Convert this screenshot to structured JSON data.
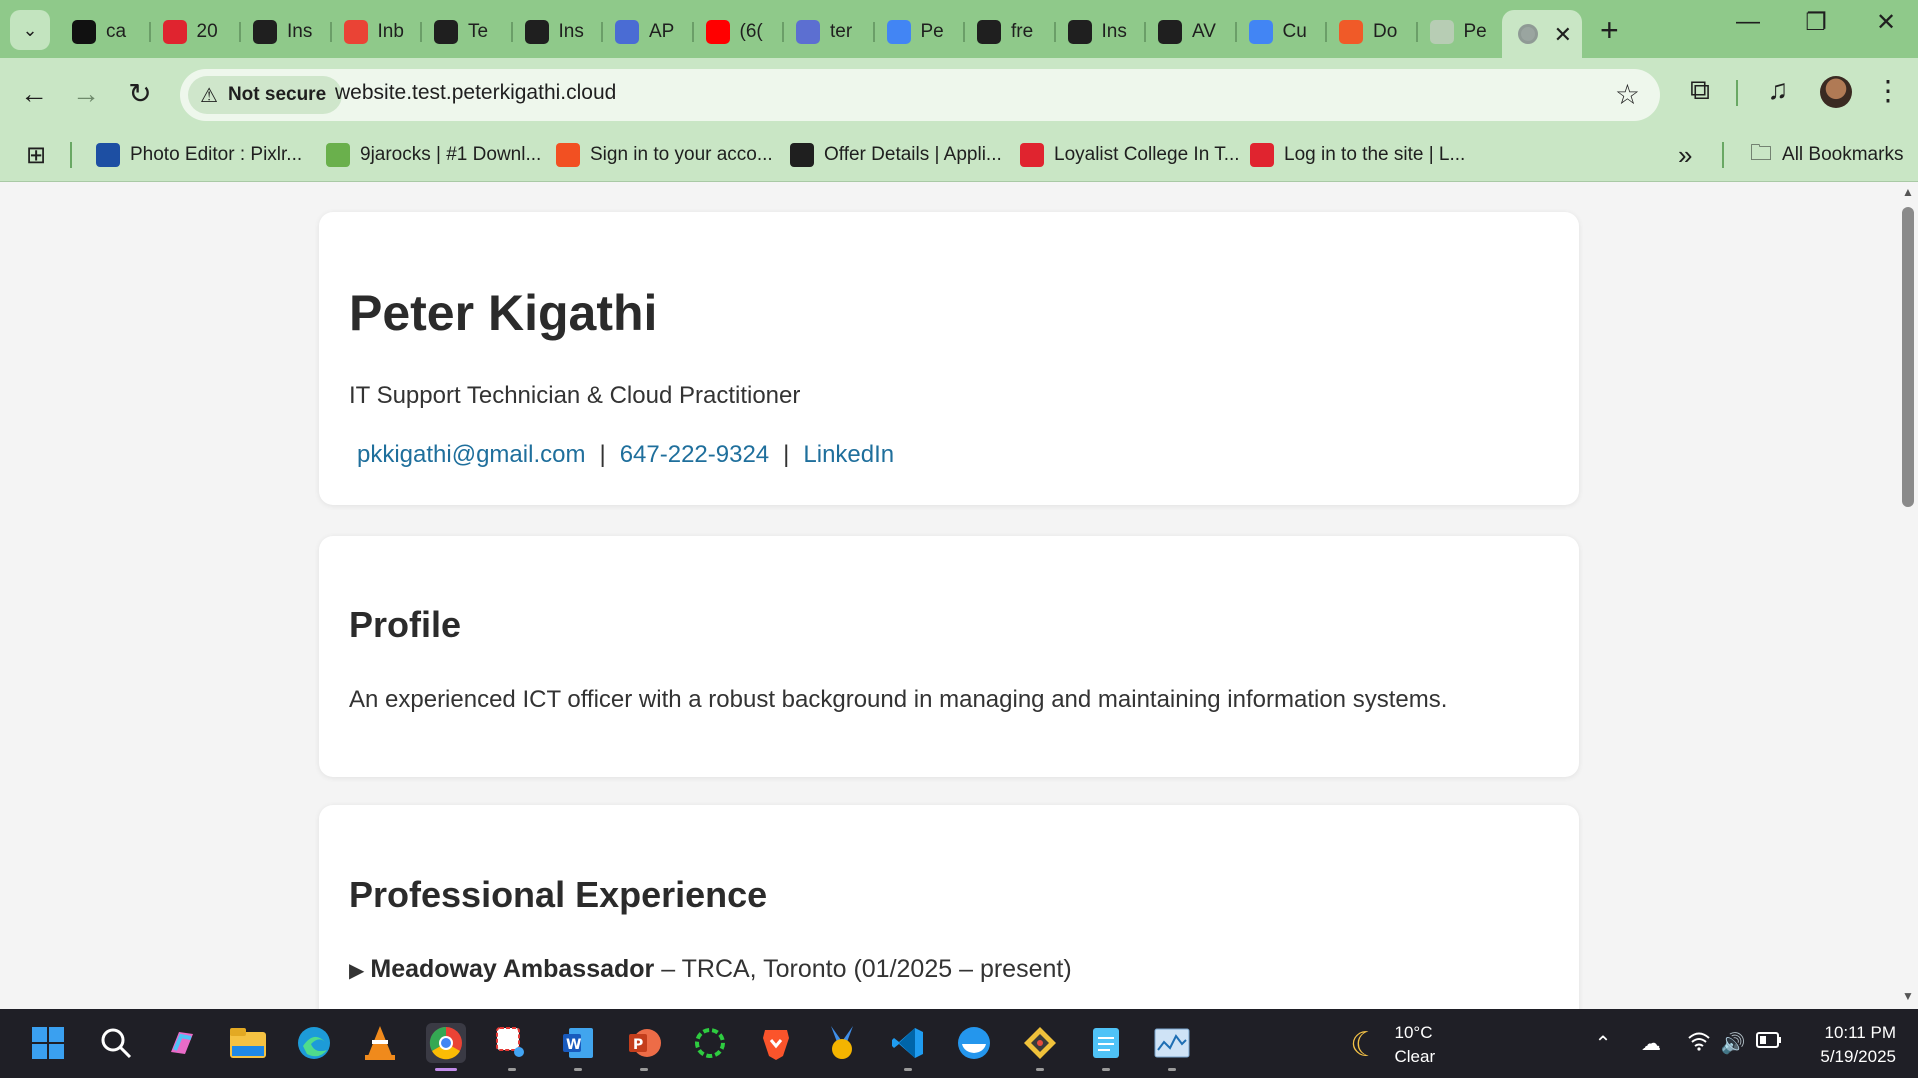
{
  "browser": {
    "tabs": [
      {
        "title": "ca",
        "icon": "tiktok-icon",
        "color": "#111111"
      },
      {
        "title": "20",
        "icon": "loyalist-icon",
        "color": "#e0242f"
      },
      {
        "title": "Ins",
        "icon": "hackerrank-icon",
        "color": "#1f1f1f"
      },
      {
        "title": "Inb",
        "icon": "gmail-icon",
        "color": "#ea4335"
      },
      {
        "title": "Te",
        "icon": "openai-icon",
        "color": "#1f1f1f"
      },
      {
        "title": "Ins",
        "icon": "openai-icon",
        "color": "#1f1f1f"
      },
      {
        "title": "AP",
        "icon": "api-icon",
        "color": "#4a6cd4"
      },
      {
        "title": "(6(",
        "icon": "youtube-icon",
        "color": "#ff0000"
      },
      {
        "title": "ter",
        "icon": "terraform-icon",
        "color": "#5c6fd1"
      },
      {
        "title": "Pe",
        "icon": "docs-icon",
        "color": "#4285f4"
      },
      {
        "title": "fre",
        "icon": "github-icon",
        "color": "#1f1f1f"
      },
      {
        "title": "Ins",
        "icon": "hackerrank-icon",
        "color": "#1f1f1f"
      },
      {
        "title": "AV",
        "icon": "openai-icon",
        "color": "#1f1f1f"
      },
      {
        "title": "Cu",
        "icon": "gcloud-icon",
        "color": "#4285f4"
      },
      {
        "title": "Do",
        "icon": "n-icon",
        "color": "#f05a28"
      },
      {
        "title": "Pe",
        "icon": "globe-faint-icon",
        "color": "#b7cdb4"
      }
    ],
    "active_tab": {
      "icon": "globe-icon",
      "close": "✕"
    },
    "new_tab": "+",
    "window_controls": {
      "minimize": "—",
      "restore": "❐",
      "close": "✕"
    },
    "security_label": "Not secure",
    "url": "website.test.peterkigathi.cloud",
    "bookmarks": [
      {
        "label": "Photo Editor : Pixlr...",
        "icon": "pixlr-icon",
        "color": "#1d4fa3"
      },
      {
        "label": "9jarocks | #1 Downl...",
        "icon": "9r-icon",
        "color": "#6ab04c"
      },
      {
        "label": "Sign in to your acco...",
        "icon": "microsoft-icon",
        "color": "#f25022"
      },
      {
        "label": "Offer Details | Appli...",
        "icon": "oc-icon",
        "color": "#1f1f1f"
      },
      {
        "label": "Loyalist College In T...",
        "icon": "loyalist-icon",
        "color": "#e0242f"
      },
      {
        "label": "Log in to the site | L...",
        "icon": "loyalist-icon",
        "color": "#e0242f"
      }
    ],
    "bookmarks_overflow": "»",
    "all_bookmarks": "All Bookmarks"
  },
  "page": {
    "name": "Peter Kigathi",
    "subtitle": "IT Support Technician & Cloud Practitioner",
    "email": "pkkigathi@gmail.com",
    "phone": "647-222-9324",
    "linkedin": "LinkedIn",
    "separator": "|",
    "profile_heading": "Profile",
    "profile_text": "An experienced ICT officer with a robust background in managing and maintaining information systems.",
    "experience_heading": "Professional Experience",
    "job_toggle": "▶",
    "job_title": "Meadoway Ambassador",
    "job_detail": " – TRCA, Toronto (01/2025 – present)"
  },
  "taskbar": {
    "weather_temp": "10°C",
    "weather_cond": "Clear",
    "time": "10:11 PM",
    "date": "5/19/2025"
  }
}
